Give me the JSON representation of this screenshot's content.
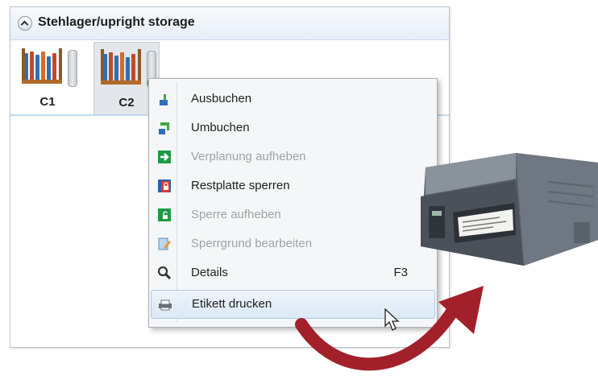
{
  "panel": {
    "title": "Stehlager/upright storage"
  },
  "bins": [
    {
      "label": "C1",
      "fill_level": 0.0,
      "selected": false
    },
    {
      "label": "C2",
      "fill_level": 0.18,
      "selected": true
    }
  ],
  "context_menu": {
    "items": [
      {
        "label": "Ausbuchen",
        "icon": "book-out-icon",
        "enabled": true,
        "shortcut": ""
      },
      {
        "label": "Umbuchen",
        "icon": "rebook-icon",
        "enabled": true,
        "shortcut": ""
      },
      {
        "label": "Verplanung aufheben",
        "icon": "cancel-planning-icon",
        "enabled": false,
        "shortcut": ""
      },
      {
        "label": "Restplatte sperren",
        "icon": "lock-plate-icon",
        "enabled": true,
        "shortcut": ""
      },
      {
        "label": "Sperre aufheben",
        "icon": "unlock-icon",
        "enabled": false,
        "shortcut": ""
      },
      {
        "label": "Sperrgrund bearbeiten",
        "icon": "edit-lock-reason-icon",
        "enabled": false,
        "shortcut": ""
      },
      {
        "label": "Details",
        "icon": "magnifier-icon",
        "enabled": true,
        "shortcut": "F3"
      },
      {
        "label": "Etikett drucken",
        "icon": "print-label-icon",
        "enabled": true,
        "shortcut": "",
        "hovered": true
      }
    ]
  },
  "colors": {
    "accent_arrow": "#a2202a",
    "gauge_fill": "#3ea843",
    "menu_hover": "#dbe8f5"
  }
}
